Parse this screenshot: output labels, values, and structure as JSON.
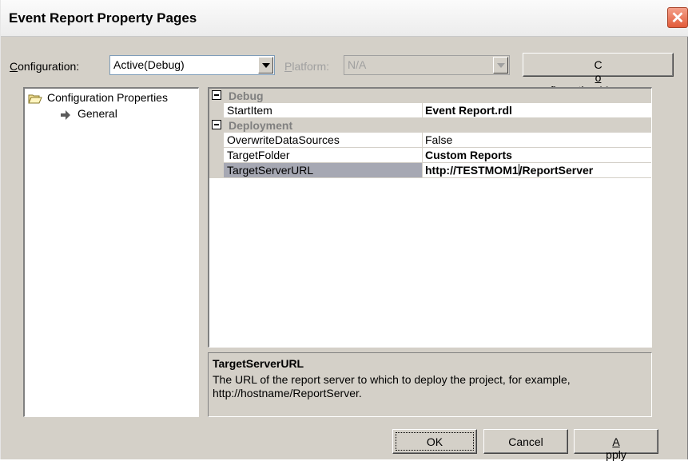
{
  "window": {
    "title": "Event Report Property Pages",
    "close_label": "✕"
  },
  "toolbar": {
    "configuration_label_accel": "C",
    "configuration_label_rest": "onfiguration:",
    "configuration_value": "Active(Debug)",
    "platform_label_accel": "P",
    "platform_label_rest": "latform:",
    "platform_value": "N/A",
    "config_manager_pre": "C",
    "config_manager_accel": "o",
    "config_manager_rest": "nfiguration Manager..."
  },
  "tree": {
    "root_label": "Configuration Properties",
    "child_label": "General"
  },
  "grid": {
    "categories": [
      {
        "label": "Debug",
        "properties": [
          {
            "name": "StartItem",
            "value": "Event Report.rdl",
            "bold": true
          }
        ]
      },
      {
        "label": "Deployment",
        "properties": [
          {
            "name": "OverwriteDataSources",
            "value": "False",
            "bold": false
          },
          {
            "name": "TargetFolder",
            "value": "Custom Reports",
            "bold": true
          },
          {
            "name": "TargetServerURL",
            "value_pre": "http://TESTMOM1",
            "value_post": "/ReportServer",
            "bold": true,
            "selected": true
          }
        ]
      }
    ]
  },
  "description": {
    "title": "TargetServerURL",
    "text": "The URL of the report server to which to deploy the project, for example, http://hostname/ReportServer."
  },
  "buttons": {
    "ok": "OK",
    "cancel": "Cancel",
    "apply_accel": "A",
    "apply_rest": "pply"
  },
  "colors": {
    "dialog_bg": "#d4d0c8",
    "close_button": "#e25b3a",
    "selected_row": "#a6a8b3"
  }
}
